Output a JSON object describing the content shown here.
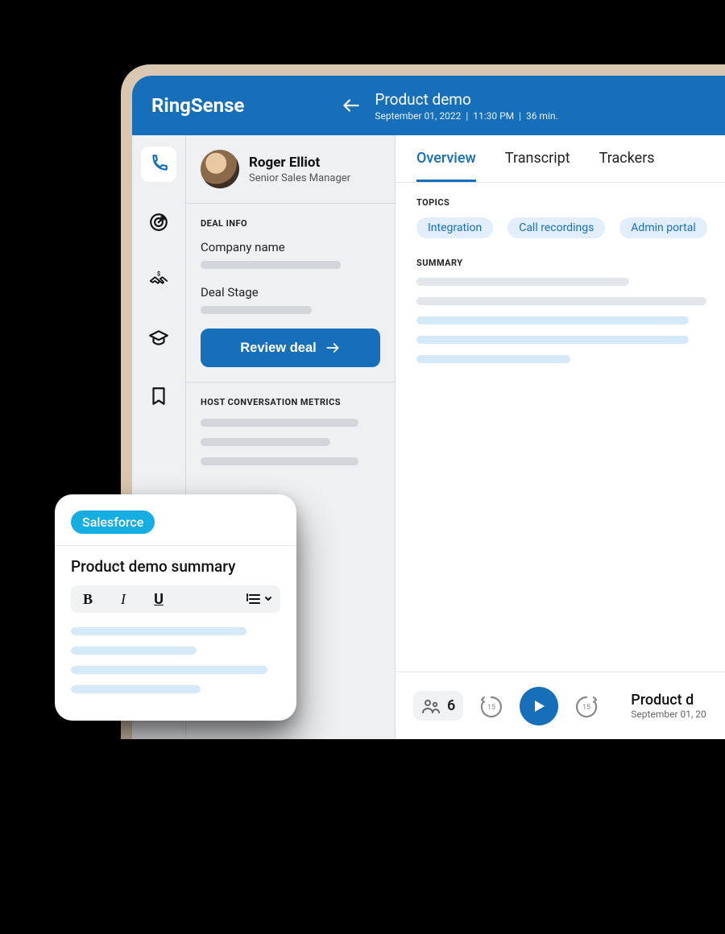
{
  "header": {
    "brand": "RingSense",
    "title": "Product demo",
    "date": "September 01, 2022",
    "time": "11:30 PM",
    "duration": "36 min."
  },
  "sidebar": {
    "items": [
      {
        "name": "calls",
        "icon": "phone-icon",
        "active": true
      },
      {
        "name": "targets",
        "icon": "target-icon"
      },
      {
        "name": "deals",
        "icon": "handshake-money-icon"
      },
      {
        "name": "education",
        "icon": "graduation-cap-icon"
      },
      {
        "name": "bookmarks",
        "icon": "bookmark-icon"
      }
    ]
  },
  "deal": {
    "person": {
      "name": "Roger Elliot",
      "role": "Senior Sales Manager"
    },
    "section1_title": "DEAL INFO",
    "company_label": "Company name",
    "stage_label": "Deal Stage",
    "button_label": "Review deal",
    "section2_title": "HOST CONVERSATION METRICS"
  },
  "content": {
    "tabs": [
      {
        "label": "Overview",
        "active": true
      },
      {
        "label": "Transcript"
      },
      {
        "label": "Trackers"
      }
    ],
    "topics_title": "TOPICS",
    "topics": [
      "Integration",
      "Call recordings",
      "Admin portal"
    ],
    "summary_title": "SUMMARY"
  },
  "player": {
    "participants_count": "6",
    "skip_seconds": "15",
    "now_title": "Product d",
    "now_date": "September 01, 20"
  },
  "card": {
    "badge": "Salesforce",
    "title": "Product demo summary"
  }
}
